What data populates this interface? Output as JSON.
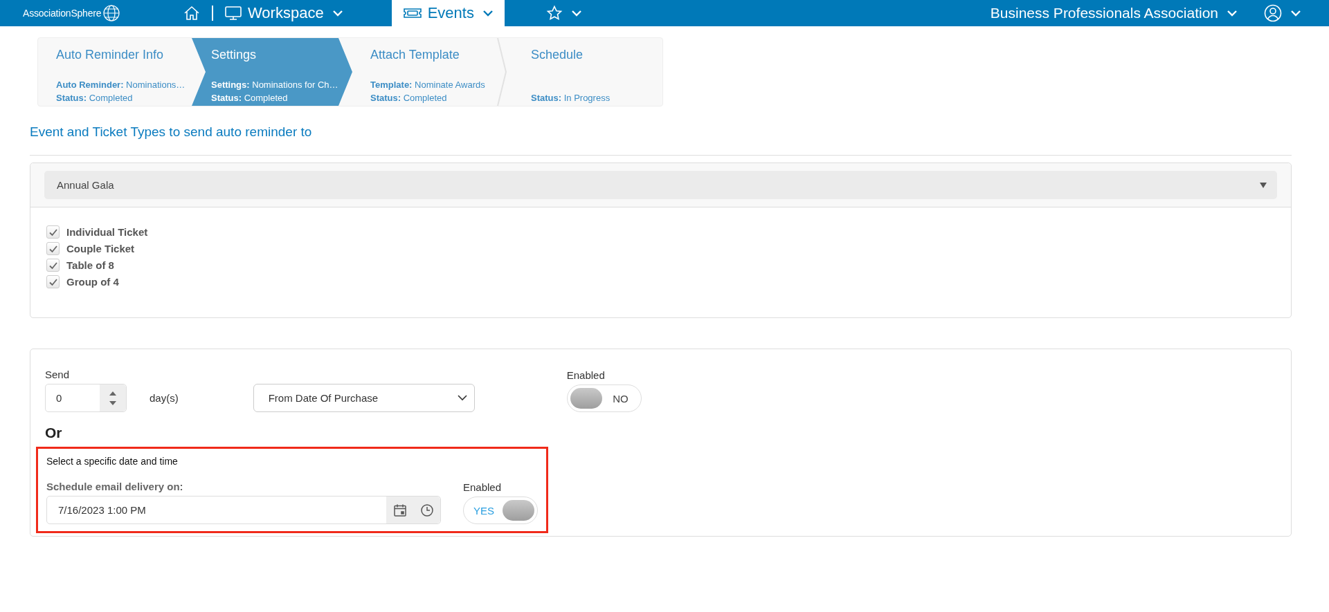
{
  "top_nav": {
    "logo": "AssociationSphere",
    "items": [
      {
        "kind": "home",
        "selected": false
      },
      {
        "kind": "menu",
        "label": "Workspace",
        "selected": false
      },
      {
        "kind": "menu",
        "label": "Events",
        "selected": true
      },
      {
        "kind": "favorites",
        "selected": false
      }
    ],
    "organization": "Business Professionals Association"
  },
  "wizard_steps": [
    {
      "title": "Auto Reminder Info",
      "selected": false,
      "lines": [
        {
          "label": "Auto Reminder:",
          "value": "Nominations…"
        },
        {
          "label": "Status:",
          "value": "Completed"
        }
      ]
    },
    {
      "title": "Settings",
      "selected": true,
      "lines": [
        {
          "label": "Settings:",
          "value": "Nominations for Ch…"
        },
        {
          "label": "Status:",
          "value": "Completed"
        }
      ]
    },
    {
      "title": "Attach Template",
      "selected": false,
      "lines": [
        {
          "label": "Template:",
          "value": "Nominate Awards"
        },
        {
          "label": "Status:",
          "value": "Completed"
        }
      ]
    },
    {
      "title": "Schedule",
      "selected": false,
      "lines": [
        {
          "label": "Status:",
          "value": "In Progress"
        }
      ]
    }
  ],
  "section_title": "Event and Ticket Types to send auto reminder to",
  "event_select": {
    "value": "Annual Gala"
  },
  "ticket_types": [
    {
      "label": "Individual Ticket",
      "checked": true
    },
    {
      "label": "Couple Ticket",
      "checked": true
    },
    {
      "label": "Table of 8",
      "checked": true
    },
    {
      "label": "Group of 4",
      "checked": true
    }
  ],
  "relative_schedule": {
    "send_label": "Send",
    "days_value": "0",
    "unit": "day(s)",
    "from": "From Date Of Purchase",
    "enabled_label": "Enabled",
    "toggle": {
      "on": false,
      "label": "NO"
    }
  },
  "or_label": "Or",
  "specific_schedule": {
    "highlighted": true,
    "title": "Select a specific date and time",
    "field_label": "Schedule email delivery on:",
    "value": "7/16/2023 1:00 PM",
    "enabled_label": "Enabled",
    "toggle": {
      "on": true,
      "label": "YES"
    }
  }
}
